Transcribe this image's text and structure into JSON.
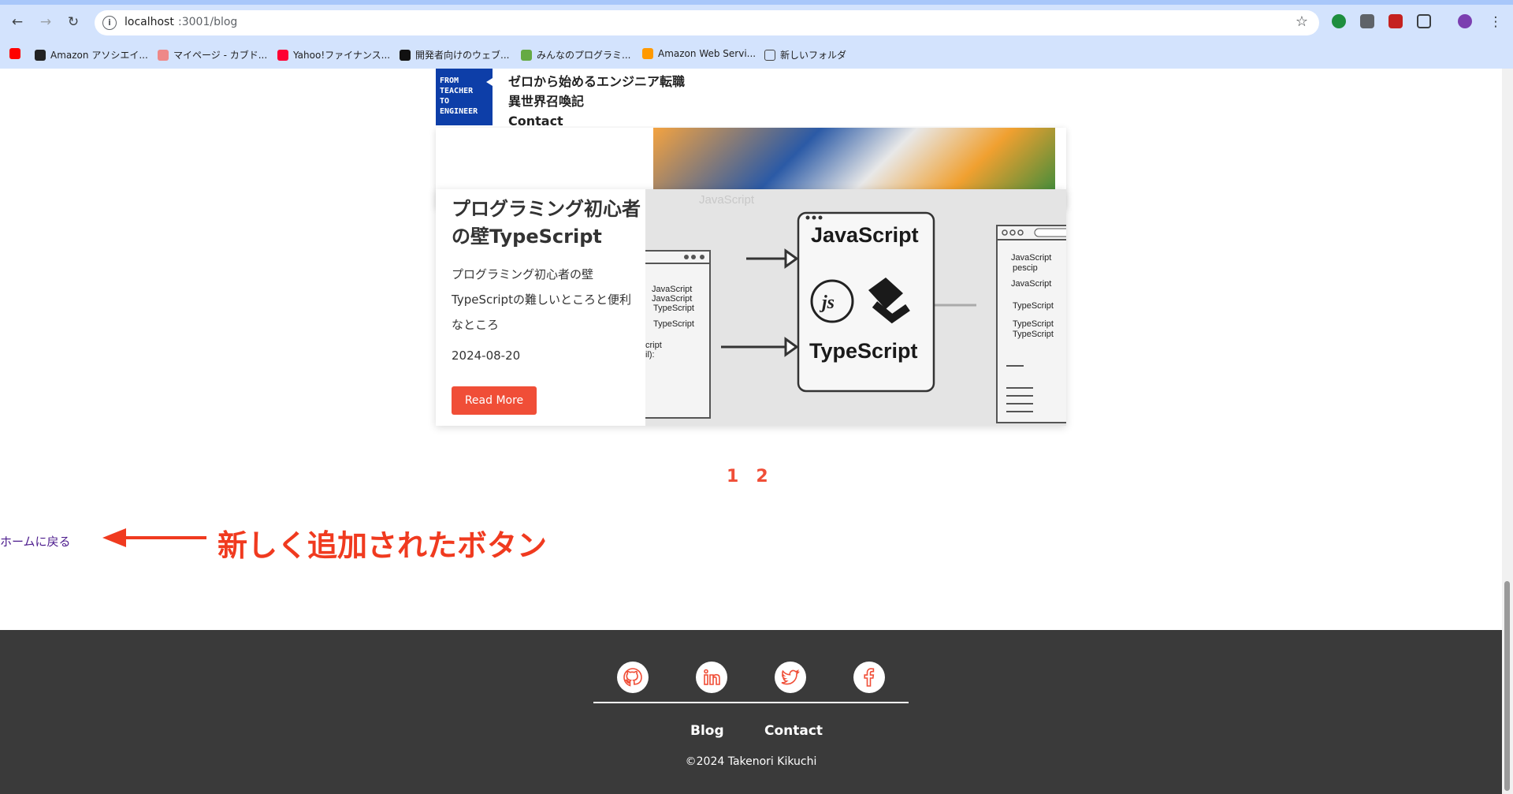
{
  "browser": {
    "url_host": "localhost",
    "url_path": ":3001/blog",
    "bookmarks": [
      "Amazon アソシエイ...",
      "マイページ - カブド...",
      "Yahoo!ファイナンス...",
      "開発者向けのウェブ...",
      "みんなのプログラミ...",
      "Amazon Web Servi...",
      "新しいフォルダ"
    ]
  },
  "header": {
    "logo_lines": [
      "FROM",
      "TEACHER",
      "TO",
      "ENGINEER"
    ],
    "nav": [
      "ゼロから始めるエンジニア転職",
      "異世界召喚記",
      "Contact"
    ]
  },
  "post": {
    "title": "プログラミング初心者の壁TypeScript",
    "excerpt": "プログラミング初心者の壁TypeScriptの難しいところと便利なところ",
    "date": "2024-08-20",
    "read_more": "Read More",
    "image": {
      "center_top": "JavaScript",
      "center_bottom": "TypeScript",
      "js_badge": "js",
      "watermark": "JavaScript",
      "left_code": [
        "JavaScript",
        "JavaScript",
        "TypeScript",
        "TypeScript",
        "cript",
        "il):"
      ],
      "right_code": [
        "JavaScript",
        "pescip",
        "JavaScript",
        "TypeScript",
        "TypeScript",
        "TypeScript"
      ]
    }
  },
  "pagination": [
    "1",
    "2"
  ],
  "home_link": "ホームに戻る",
  "annotation": "新しく追加されたボタン",
  "footer": {
    "social": [
      "github-icon",
      "linkedin-icon",
      "twitter-icon",
      "facebook-icon"
    ],
    "links": [
      "Blog",
      "Contact"
    ],
    "copyright": "©2024 Takenori Kikuchi"
  },
  "colors": {
    "accent": "#f04e37",
    "footer_bg": "#3a3a3a",
    "logo_bg": "#0d3ea8"
  }
}
